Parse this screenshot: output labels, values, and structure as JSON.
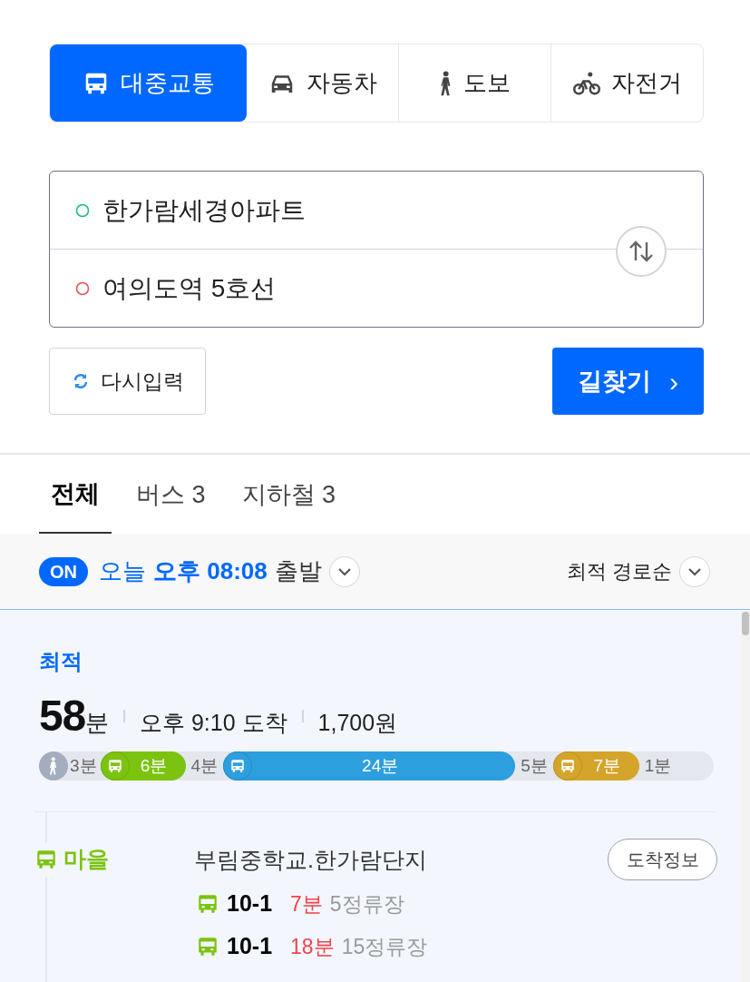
{
  "modes": [
    {
      "kind": "transit",
      "label": "대중교통",
      "selected": true
    },
    {
      "kind": "car",
      "label": "자동차",
      "selected": false
    },
    {
      "kind": "walk",
      "label": "도보",
      "selected": false
    },
    {
      "kind": "bike",
      "label": "자전거",
      "selected": false
    }
  ],
  "origin": {
    "value": "한가람세경아파트"
  },
  "destination": {
    "value": "여의도역 5호선"
  },
  "reset_button": "다시입력",
  "search_button": "길찾기",
  "search_arrow": "›",
  "tabs": [
    {
      "label": "전체",
      "selected": true
    },
    {
      "label": "버스 3",
      "selected": false
    },
    {
      "label": "지하철 3",
      "selected": false
    }
  ],
  "departure": {
    "toggle": "ON",
    "on": true,
    "day": "오늘",
    "time": "오후 08:08",
    "suffix": "출발"
  },
  "sort": "최적 경로순",
  "route": {
    "badge": "최적",
    "minutes": "58",
    "minutes_unit": "분",
    "arrival": "오후 9:10 도착",
    "fare": "1,700원",
    "segments": [
      {
        "kind": "walk",
        "label": "3분"
      },
      {
        "kind": "bus",
        "label": "6분",
        "color": "#7cc310"
      },
      {
        "kind": "gap",
        "label": "4분"
      },
      {
        "kind": "subway",
        "label": "24분",
        "color": "#2d9fdf"
      },
      {
        "kind": "gap",
        "label": "5분"
      },
      {
        "kind": "subway_short",
        "label": "7분",
        "color": "#d4a52a"
      },
      {
        "kind": "gap",
        "label": "1분"
      }
    ],
    "step": {
      "line": "마을",
      "color": "#7cc310",
      "stop": "부림중학교.한가람단지",
      "arrival_button": "도착정보",
      "buses": [
        {
          "number": "10-1",
          "time": "7분",
          "stops": "5정류장"
        },
        {
          "number": "10-1",
          "time": "18분",
          "stops": "15정류장"
        }
      ]
    }
  }
}
